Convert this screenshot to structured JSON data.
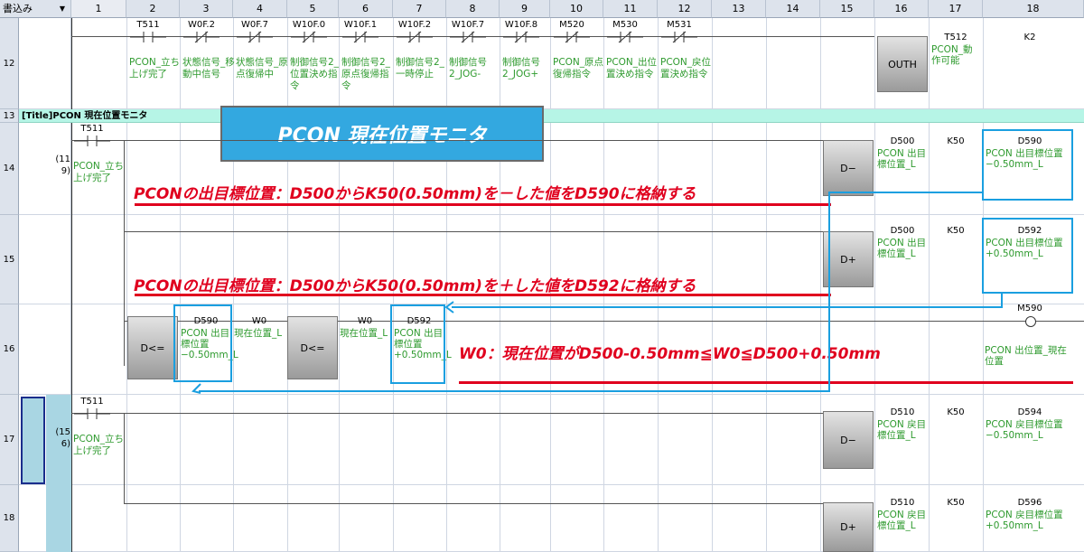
{
  "mode": "書込み",
  "columns": [
    "1",
    "2",
    "3",
    "4",
    "5",
    "6",
    "7",
    "8",
    "9",
    "10",
    "11",
    "12",
    "13",
    "14",
    "15",
    "16",
    "17",
    "18"
  ],
  "rows": {
    "r12": "12",
    "r13": "13",
    "r14": "14",
    "r15": "15",
    "r16": "16",
    "r17": "17",
    "r18": "18"
  },
  "row12": {
    "contacts": [
      {
        "dev": "T511",
        "label": "PCON_立ち上げ完了"
      },
      {
        "dev": "W0F.2",
        "label": "状態信号_移動中信号"
      },
      {
        "dev": "W0F.7",
        "label": "状態信号_原点復帰中"
      },
      {
        "dev": "W10F.0",
        "label": "制御信号2_位置決め指令"
      },
      {
        "dev": "W10F.1",
        "label": "制御信号2_原点復帰指令"
      },
      {
        "dev": "W10F.2",
        "label": "制御信号2_一時停止"
      },
      {
        "dev": "W10F.7",
        "label": "制御信号2_JOG-"
      },
      {
        "dev": "W10F.8",
        "label": "制御信号2_JOG+"
      },
      {
        "dev": "M520",
        "label": "PCON_原点復帰指令"
      },
      {
        "dev": "M530",
        "label": "PCON_出位置決め指令"
      },
      {
        "dev": "M531",
        "label": "PCON_戻位置決め指令"
      }
    ],
    "inst": "OUTH",
    "op1": {
      "dev": "T512",
      "label": "PCON_動作可能"
    },
    "op2": {
      "dev": "K2"
    }
  },
  "row13": {
    "title": "[Title]PCON 現在位置モニタ"
  },
  "banner": "PCON 現在位置モニタ",
  "row14": {
    "step": "(11\n9)",
    "contact": {
      "dev": "T511",
      "label": "PCON_立ち上げ完了"
    },
    "inst": "D−",
    "s1": {
      "dev": "D500",
      "label": "PCON 出目標位置_L"
    },
    "s2": {
      "dev": "K50"
    },
    "d": {
      "dev": "D590",
      "label": "PCON 出目標位置−0.50mm_L"
    },
    "note": "PCONの出目標位置：D500からK50(0.50mm)を－した値をD590に格納する"
  },
  "row15": {
    "inst": "D+",
    "s1": {
      "dev": "D500",
      "label": "PCON 出目標位置_L"
    },
    "s2": {
      "dev": "K50"
    },
    "d": {
      "dev": "D592",
      "label": "PCON 出目標位置+0.50mm_L"
    },
    "note": "PCONの出目標位置：D500からK50(0.50mm)を＋した値をD592に格納する"
  },
  "row16": {
    "inst1": "D<=",
    "a1": {
      "dev": "D590",
      "label": "PCON 出目標位置−0.50mm_L"
    },
    "b1": {
      "dev": "W0",
      "label": "現在位置_L"
    },
    "inst2": "D<=",
    "a2": {
      "dev": "W0",
      "label": "現在位置_L"
    },
    "b2": {
      "dev": "D592",
      "label": "PCON 出目標位置+0.50mm_L"
    },
    "coil": {
      "dev": "M590",
      "label": "PCON 出位置_現在位置"
    },
    "note": "W0：現在位置がD500-0.50mm≦W0≦D500+0.50mm"
  },
  "row17": {
    "step": "(15\n6)",
    "contact": {
      "dev": "T511",
      "label": "PCON_立ち上げ完了"
    },
    "inst": "D−",
    "s1": {
      "dev": "D510",
      "label": "PCON 戻目標位置_L"
    },
    "s2": {
      "dev": "K50"
    },
    "d": {
      "dev": "D594",
      "label": "PCON 戻目標位置−0.50mm_L"
    }
  },
  "row18": {
    "inst": "D+",
    "s1": {
      "dev": "D510",
      "label": "PCON 戻目標位置_L"
    },
    "s2": {
      "dev": "K50"
    },
    "d": {
      "dev": "D596",
      "label": "PCON 戻目標位置+0.50mm_L"
    }
  }
}
